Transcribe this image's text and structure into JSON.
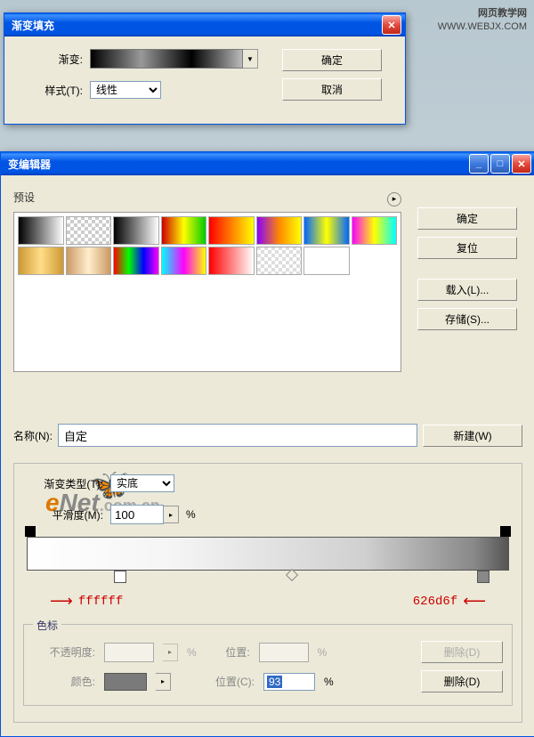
{
  "watermark": {
    "line1": "网页教学网",
    "line2": "WWW.WEBJX.COM"
  },
  "dialog1": {
    "title": "渐变填充",
    "gradient_label": "渐变:",
    "style_label": "样式(T):",
    "style_value": "线性",
    "ok": "确定",
    "cancel": "取消"
  },
  "dialog2": {
    "title": "变编辑器",
    "preset_label": "预设",
    "ok": "确定",
    "reset": "复位",
    "load": "载入(L)...",
    "save": "存储(S)...",
    "name_label": "名称(N):",
    "name_value": "自定",
    "new_btn": "新建(W)",
    "grad_type_label": "渐变类型(T):",
    "grad_type_value": "实底",
    "smooth_label": "平滑度(M):",
    "smooth_value": "100",
    "smooth_unit": "%",
    "anno_left": "ffffff",
    "anno_right": "626d6f",
    "cs_legend": "色标",
    "opacity_label": "不透明度:",
    "opacity_unit": "%",
    "pos1_label": "位置:",
    "pos1_unit": "%",
    "delete1": "删除(D)",
    "color_label": "颜色:",
    "pos2_label": "位置(C):",
    "pos2_value": "93",
    "pos2_unit": "%",
    "delete2": "删除(D)"
  },
  "swatch_bg": [
    "linear-gradient(to right,#000,#fff)",
    "repeating-conic-gradient(#ccc 0 25%,#fff 0 50%) 0/8px 8px",
    "linear-gradient(to right,#000,#fff)",
    "linear-gradient(to right,#c00,#ff0,#0c0)",
    "linear-gradient(to right,#f00,#ff0)",
    "linear-gradient(to right,#80f,#f80,#ff0)",
    "linear-gradient(to right,#06f,#ff0,#06f)",
    "linear-gradient(to right,#f0f,#ff0,#0ff)",
    "linear-gradient(to right,#c93,#fd8,#c93)",
    "linear-gradient(to right,#c96,#fec,#c96)",
    "linear-gradient(to right,#f00,#0f0,#00f,#f0f)",
    "linear-gradient(to right,#0ff,#f0f,#ff0)",
    "linear-gradient(to right,#f00,#fff)",
    "repeating-conic-gradient(#ddd 0 25%,#fff 0 50%) 0/8px 8px",
    "#fff",
    ""
  ]
}
